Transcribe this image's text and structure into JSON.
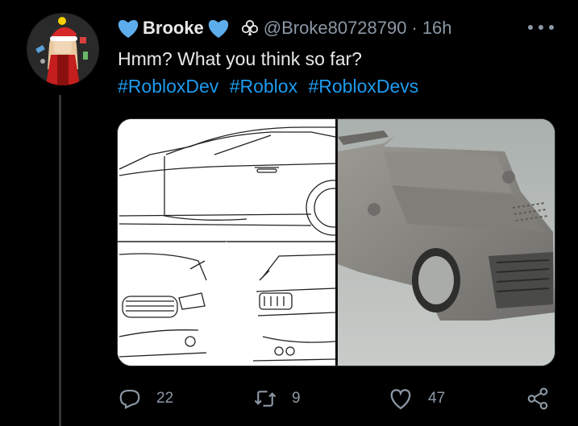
{
  "tweet": {
    "display_name": "Brooke",
    "name_emoji": "blue-heart-icon",
    "badge_icon": "club-badge-icon",
    "handle": "@Broke80728790",
    "separator": "·",
    "time": "16h",
    "text": "Hmm? What you think so far?",
    "hashtags": [
      "#RobloxDev",
      "#Roblox",
      "#RobloxDevs"
    ],
    "media": {
      "panels": [
        "car-side-line-drawing",
        "car-front-line-drawing",
        "car-rear-line-drawing",
        "car-3d-render"
      ]
    }
  },
  "actions": {
    "reply_count": "22",
    "retweet_count": "9",
    "like_count": "47",
    "share_icon": "share-icon"
  },
  "colors": {
    "background": "#000000",
    "accent": "#1d9bf0",
    "secondary_text": "#8b98a5",
    "primary_text": "#e7e9ea"
  }
}
